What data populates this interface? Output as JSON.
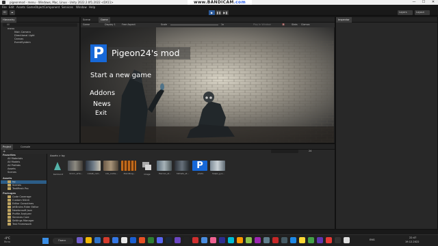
{
  "window": {
    "title": "pigeonmod - menu - Windows, Mac, Linux - Unity 2022.2.0f1.2022 <DX11>",
    "controls": [
      "—",
      "☐",
      "✕"
    ]
  },
  "recorder_overlay": {
    "prefix": "www.",
    "brand": "BANDICAM",
    "suffix": ".com"
  },
  "menu": [
    "File",
    "Edit",
    "Assets",
    "GameObject",
    "Component",
    "Services",
    "Window",
    "Help"
  ],
  "toolbar": {
    "account": "ID",
    "cloud": "☁",
    "play_controls": [
      "▶",
      "❚❚",
      "▶❚"
    ],
    "layers": "Layers",
    "layout": "Layout"
  },
  "hierarchy": {
    "tab": "Hierarchy",
    "search_placeholder": "All",
    "scene": "menu",
    "items": [
      "Main Camera",
      "Directional Light",
      "Canvas",
      "EventSystem"
    ]
  },
  "scene_tabs": {
    "scene": "Scene",
    "game": "Game",
    "display": "Game",
    "display_num": "Display 1",
    "aspect": "Free Aspect",
    "scale_label": "Scale",
    "scale_value": "1x",
    "play_mode": "Play In Window",
    "mute": "🔇",
    "stats": "Stats",
    "gizmos": "Gizmos"
  },
  "game_ui": {
    "logo_letter": "P",
    "title": "Pigeon24's mod",
    "start": "Start a new game",
    "addons": "Addons",
    "news": "News",
    "exit": "Exit"
  },
  "inspector": {
    "tab": "Inspector"
  },
  "project": {
    "tabs": [
      "Project",
      "Console"
    ],
    "add": "+",
    "breadcrumb": "Assets > bg",
    "favorites_title": "Favorites",
    "favorites": [
      "All Materials",
      "All Models",
      "All Prefabs",
      "Assets",
      "Scenes"
    ],
    "assets_title": "Assets",
    "assets": [
      "bg",
      "Scenes",
      "TextMesh Pro"
    ],
    "packages_title": "Packages",
    "packages": [
      "Code Coverage",
      "Custom NUnit",
      "Editor Coroutines",
      "JetBrains Rider Editor",
      "Newtonsoft Json",
      "Profile Analyzer",
      "Services Core",
      "Settings Manager",
      "Test Framework"
    ],
    "files": [
      "backound",
      "bronx_arta...",
      "cobalt_cad...",
      "cob_conte...",
      "dlandbug...",
      "image",
      "Hercan_st...",
      "hilmets_st...",
      "photo",
      "hesps_g.a..."
    ],
    "count": "24"
  },
  "taskbar": {
    "weather_temp": "-4°C",
    "weather_desc": "Ясно",
    "search": "Поиск",
    "lang": "ENG",
    "time": "22:47",
    "date": "19.12.2022"
  },
  "colors": {
    "accent": "#2d5b9a",
    "logo_bg": "#1768d8",
    "folder": "#bfa562",
    "panel": "#282828"
  }
}
